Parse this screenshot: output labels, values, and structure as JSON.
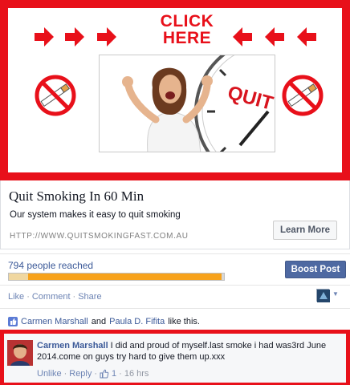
{
  "ad": {
    "cta_line1": "CLICK",
    "cta_line2": "HERE",
    "title": "Quit Smoking In 60 Min",
    "description": "Our system makes it easy to quit smoking",
    "url": "HTTP://WWW.QUITSMOKINGFAST.COM.AU",
    "learn_more": "Learn More",
    "clock_text": "QUIT"
  },
  "stats": {
    "reach": "794 people reached",
    "reach_fraction": 0.99,
    "boost_label": "Boost Post"
  },
  "actions": {
    "like": "Like",
    "comment": "Comment",
    "share": "Share",
    "sep": "·"
  },
  "likes": {
    "person1": "Carmen Marshall",
    "and": "and",
    "person2": "Paula D. Fifita",
    "suffix": "like this."
  },
  "comment": {
    "author": "Carmen Marshall",
    "text": "I did and proud of myself.last smoke i had was3rd June 2014.come on guys try hard to give them up.xxx",
    "unlike": "Unlike",
    "reply": "Reply",
    "likes_count": "1",
    "time": "16 hrs",
    "sep": "·"
  },
  "colors": {
    "ad_border": "#e8101a",
    "link": "#3b5998",
    "boost": "#4e69a2",
    "reach_bar": "#f7a21b"
  }
}
